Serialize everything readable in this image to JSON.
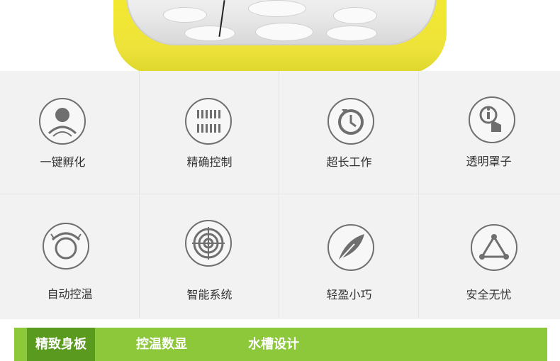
{
  "features": [
    {
      "label": "一键孵化",
      "icon": "person-icon"
    },
    {
      "label": "精确控制",
      "icon": "precise-control-icon"
    },
    {
      "label": "超长工作",
      "icon": "timer-icon"
    },
    {
      "label": "透明罩子",
      "icon": "transparent-cover-icon"
    },
    {
      "label": "自动控温",
      "icon": "auto-temp-icon"
    },
    {
      "label": "智能系统",
      "icon": "smart-target-icon"
    },
    {
      "label": "轻盈小巧",
      "icon": "feather-icon"
    },
    {
      "label": "安全无忧",
      "icon": "safety-triangle-icon"
    }
  ],
  "tabs": [
    {
      "label": "精致身板",
      "active": true
    },
    {
      "label": "控温数显",
      "active": false
    },
    {
      "label": "水槽设计",
      "active": false
    }
  ],
  "colors": {
    "tab_bar": "#8cc83a",
    "tab_active": "#5a9a1e",
    "icon_stroke": "#6f6f6f"
  }
}
